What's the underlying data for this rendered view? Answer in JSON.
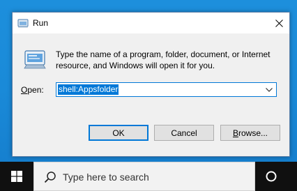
{
  "dialog": {
    "title": "Run",
    "close_label": "Close",
    "description": "Type the name of a program, folder, document, or Internet resource, and Windows will open it for you.",
    "open_label_access": "O",
    "open_label_rest": "pen:",
    "open_value": "shell:Appsfolder",
    "buttons": {
      "ok": "OK",
      "cancel": "Cancel",
      "browse_access": "B",
      "browse_rest": "rowse..."
    }
  },
  "taskbar": {
    "search_placeholder": "Type here to search",
    "icons": [
      "windows-start-icon",
      "search-icon",
      "cortana-icon"
    ]
  },
  "colors": {
    "desktop": "#1a8ad8",
    "accent": "#0078d7",
    "taskbar": "#101010"
  }
}
